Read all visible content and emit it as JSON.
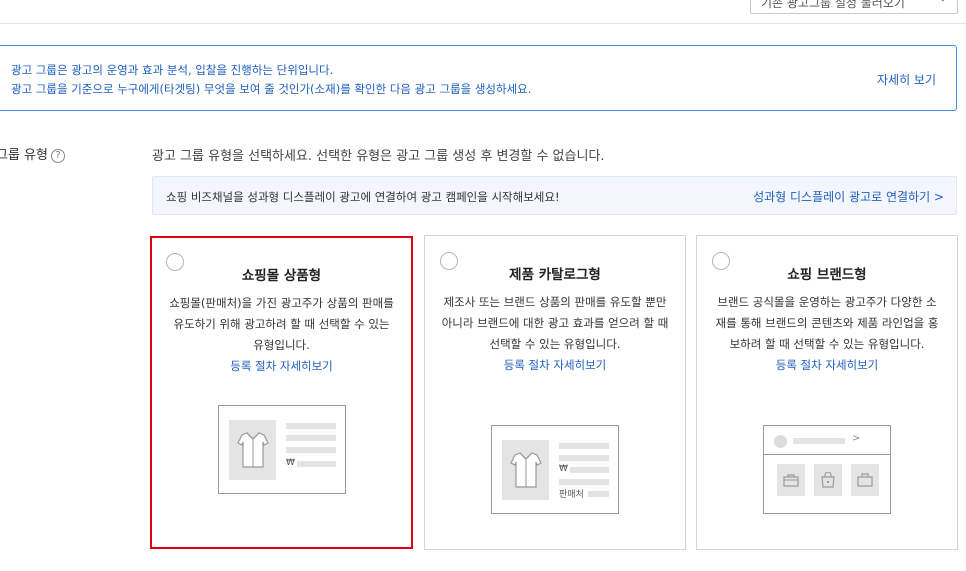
{
  "top": {
    "dropdown_label": "기존 광고그룹 설정 불러오기",
    "dropdown_chevron": "chevron-down-icon"
  },
  "info": {
    "line1": "광고 그룹은 광고의 운영과 효과 분석, 입찰을 진행하는 단위입니다.",
    "line2": "광고 그룹을 기준으로 누구에게(타겟팅) 무엇을 보여 줄 것인가(소재)를 확인한 다음 광고 그룹을 생성하세요.",
    "more": "자세히 보기"
  },
  "row": {
    "label": "그룹 유형",
    "help": "?",
    "description": "광고 그룹 유형을 선택하세요. 선택한 유형은 광고 그룹 생성 후 변경할 수 없습니다."
  },
  "promo": {
    "text": "쇼핑 비즈채널을 성과형 디스플레이 광고에 연결하여 광고 캠페인을 시작해보세요!",
    "link": "성과형 디스플레이 광고로 연결하기 >"
  },
  "cards": [
    {
      "title": "쇼핑몰 상품형",
      "desc": "쇼핑몰(판매처)을 가진 광고주가 상품의 판매를 유도하기 위해 광고하려 할 때 선택할 수 있는 유형입니다.",
      "link": "등록 절차 자세히보기",
      "won": "₩"
    },
    {
      "title": "제품 카탈로그형",
      "desc": "제조사 또는 브랜드 상품의 판매를 유도할 뿐만 아니라 브랜드에 대한 광고 효과를 얻으려 할 때 선택할 수 있는 유형입니다.",
      "link": "등록 절차 자세히보기",
      "won": "₩",
      "seller": "판매처"
    },
    {
      "title": "쇼핑 브랜드형",
      "desc": "브랜드 공식몰을 운영하는 광고주가 다양한 소재를 통해 브랜드의 콘텐츠와 제품 라인업을 홍보하려 할 때 선택할 수 있는 유형입니다.",
      "link": "등록 절차 자세히보기",
      "chevron": ">"
    }
  ],
  "colors": {
    "accent_blue": "#1f5fbf",
    "selected_border": "#e0000f",
    "info_border": "#4a90e2",
    "promo_bg": "#f3f6fc"
  }
}
